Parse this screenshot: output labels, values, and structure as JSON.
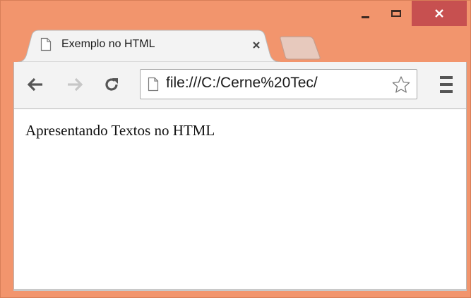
{
  "window": {
    "frame_color": "#f2956d",
    "close_color": "#c75050"
  },
  "tab": {
    "title": "Exemplo no HTML",
    "icon": "page-icon",
    "close_icon": "close-icon"
  },
  "toolbar": {
    "back_icon": "back-arrow-icon",
    "forward_icon": "forward-arrow-icon",
    "reload_icon": "reload-icon",
    "url": "file:///C:/Cerne%20Tec/",
    "star_icon": "bookmark-star-icon",
    "menu_icon": "hamburger-menu-icon"
  },
  "page": {
    "text": "Apresentando Textos no HTML"
  }
}
